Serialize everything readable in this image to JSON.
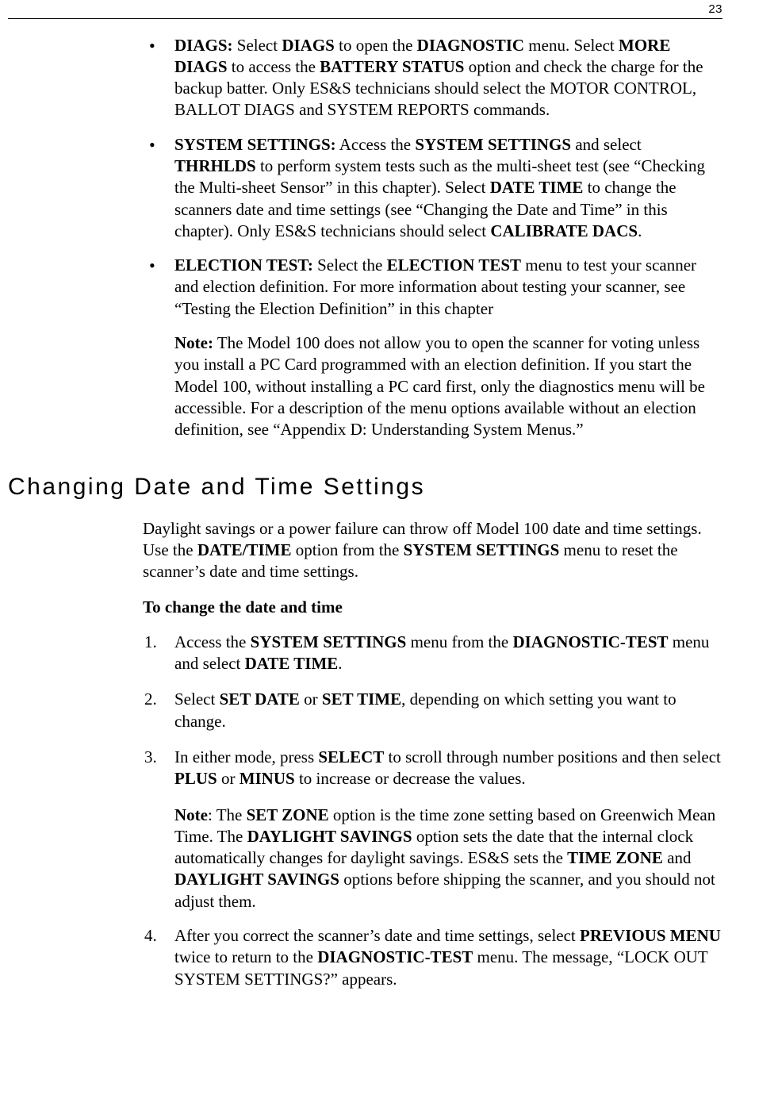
{
  "page_number": "23",
  "bullets": [
    {
      "html": "<b>DIAGS:</b> Select <b>DIAGS</b> to open the <b>DIAGNOSTIC</b> menu. Select <b>MORE DIAGS</b> to access the <b>BATTERY STATUS</b> option and check the charge for the backup batter. Only ES&S technicians should select the MOTOR CONTROL, BALLOT DIAGS and SYSTEM REPORTS commands."
    },
    {
      "html": "<b>SYSTEM SETTINGS:</b> Access the <b>SYSTEM SETTINGS</b> and select <b>THRHLDS</b> to perform system tests such as the multi-sheet test (see “Checking the Multi-sheet Sensor” in this chapter). Select <b>DATE TIME</b> to change the scanners date and time settings (see “Changing the Date and Time” in this chapter). Only ES&S technicians should select <b>CALIBRATE DACS</b>."
    },
    {
      "html": "<b>ELECTION TEST:</b> Select the <b>ELECTION TEST</b> menu to test your scanner and election definition. For more information about testing your scanner, see “Testing the Election Definition” in this chapter",
      "note_html": "<b>Note:</b> The Model 100 does not allow you to open the scanner for voting unless you install a PC Card programmed with an election definition. If you start the Model 100, without installing a PC card first, only the diagnostics menu will be accessible. For a description of the menu options available without an election definition, see “Appendix D: Understanding System Menus.”"
    }
  ],
  "heading": "Changing Date and Time Settings",
  "intro_html": "Daylight savings or a power failure can throw off Model 100 date and time settings. Use the <b>DATE/TIME</b> option from the <b>SYSTEM SETTINGS</b> menu to reset the scanner’s date and time settings.",
  "procedure_title": "To change the date and time",
  "steps": [
    {
      "num": "1.",
      "html": "Access the <b>SYSTEM SETTINGS</b> menu from the <b>DIAGNOSTIC-TEST</b> menu and select <b>DATE TIME</b>."
    },
    {
      "num": "2.",
      "html": "Select <b>SET DATE</b> or <b>SET TIME</b>, depending on which setting you want to change."
    },
    {
      "num": "3.",
      "html": "In either mode, press <b>SELECT</b> to scroll through number positions and then select <b>PLUS</b> or <b>MINUS</b> to increase or decrease the values.",
      "note_html": "<b>Note</b>:  The <b>SET ZONE</b> option is the time zone setting based on Greenwich Mean Time. The <b>DAYLIGHT SAVINGS</b> option sets the date that the internal clock automatically changes for daylight savings. ES&S sets the <b>TIME ZONE</b> and <b>DAYLIGHT SAVINGS</b> options before shipping the scanner, and you should not adjust them."
    },
    {
      "num": "4.",
      "html": "After you correct the scanner’s date and time settings, select <b>PREVIOUS MENU</b> twice to return to the <b>DIAGNOSTIC-TEST</b> menu. The message, “LOCK OUT SYSTEM SETTINGS?” appears."
    }
  ]
}
